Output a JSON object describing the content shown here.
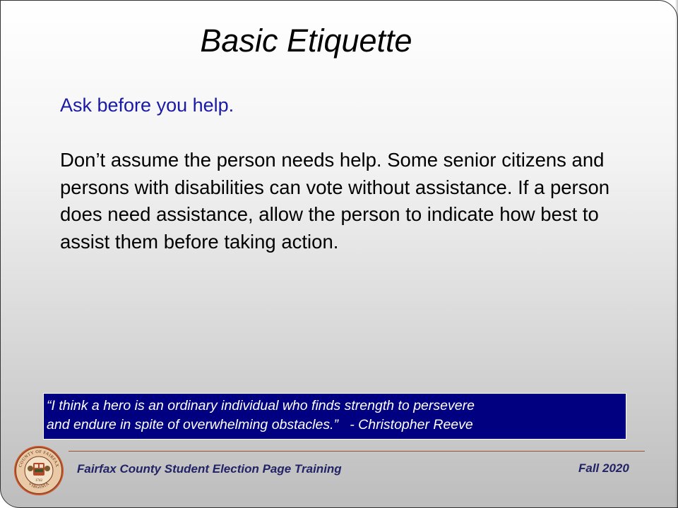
{
  "slide": {
    "title": "Basic Etiquette",
    "subtitle": "Ask before you help.",
    "body": "Don’t assume the person needs help. Some senior citizens and persons with disabilities can vote without assistance. If a person does need assistance, allow the person to indicate how best to assist them before taking action.",
    "quote": {
      "line1": "“I think a hero is an ordinary individual who finds strength to persevere",
      "line2": "and endure in spite of overwhelming obstacles.”   - Christopher Reeve"
    }
  },
  "footer": {
    "left_text": "Fairfax County Student Election Page Training",
    "right_text": "Fall 2020",
    "seal": {
      "top_text": "COUNTY OF FAIRFAX",
      "bottom_text": "VIRGINIA",
      "year": "1742"
    }
  },
  "colors": {
    "subtitle": "#1a1aa6",
    "quote_background": "#000080",
    "footer_rule": "#a0522d",
    "footer_text": "#222266"
  }
}
